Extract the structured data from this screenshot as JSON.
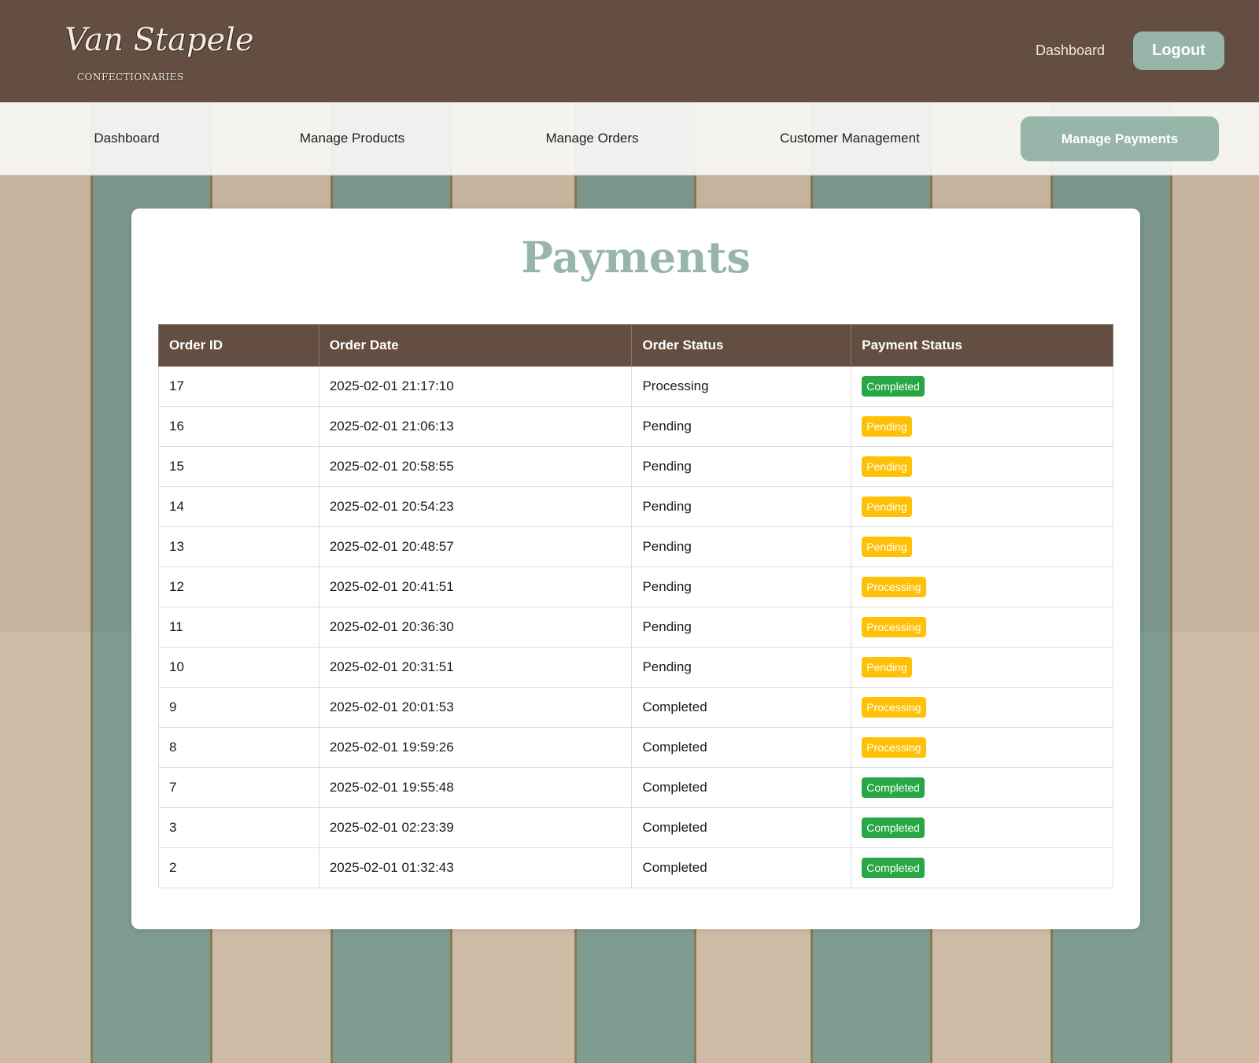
{
  "header": {
    "logo_text": "Van Stapele",
    "logo_subtitle": "CONFECTIONARIES",
    "dashboard_link": "Dashboard",
    "logout_label": "Logout"
  },
  "nav": {
    "items": [
      {
        "label": "Dashboard",
        "active": false
      },
      {
        "label": "Manage Products",
        "active": false
      },
      {
        "label": "Manage Orders",
        "active": false
      },
      {
        "label": "Customer Management",
        "active": false
      },
      {
        "label": "Manage Payments",
        "active": true
      }
    ]
  },
  "main": {
    "title": "Payments",
    "table": {
      "columns": [
        "Order ID",
        "Order Date",
        "Order Status",
        "Payment Status"
      ],
      "rows": [
        {
          "order_id": "17",
          "order_date": "2025-02-01 21:17:10",
          "order_status": "Processing",
          "payment_status": "Completed"
        },
        {
          "order_id": "16",
          "order_date": "2025-02-01 21:06:13",
          "order_status": "Pending",
          "payment_status": "Pending"
        },
        {
          "order_id": "15",
          "order_date": "2025-02-01 20:58:55",
          "order_status": "Pending",
          "payment_status": "Pending"
        },
        {
          "order_id": "14",
          "order_date": "2025-02-01 20:54:23",
          "order_status": "Pending",
          "payment_status": "Pending"
        },
        {
          "order_id": "13",
          "order_date": "2025-02-01 20:48:57",
          "order_status": "Pending",
          "payment_status": "Pending"
        },
        {
          "order_id": "12",
          "order_date": "2025-02-01 20:41:51",
          "order_status": "Pending",
          "payment_status": "Processing"
        },
        {
          "order_id": "11",
          "order_date": "2025-02-01 20:36:30",
          "order_status": "Pending",
          "payment_status": "Processing"
        },
        {
          "order_id": "10",
          "order_date": "2025-02-01 20:31:51",
          "order_status": "Pending",
          "payment_status": "Pending"
        },
        {
          "order_id": "9",
          "order_date": "2025-02-01 20:01:53",
          "order_status": "Completed",
          "payment_status": "Processing"
        },
        {
          "order_id": "8",
          "order_date": "2025-02-01 19:59:26",
          "order_status": "Completed",
          "payment_status": "Processing"
        },
        {
          "order_id": "7",
          "order_date": "2025-02-01 19:55:48",
          "order_status": "Completed",
          "payment_status": "Completed"
        },
        {
          "order_id": "3",
          "order_date": "2025-02-01 02:23:39",
          "order_status": "Completed",
          "payment_status": "Completed"
        },
        {
          "order_id": "2",
          "order_date": "2025-02-01 01:32:43",
          "order_status": "Completed",
          "payment_status": "Completed"
        }
      ]
    }
  },
  "colors": {
    "brand_brown": "#644e42",
    "accent_sage": "#97b5a8",
    "status_completed": "#28a745",
    "status_pending": "#ffc107",
    "status_processing": "#ffc107"
  }
}
